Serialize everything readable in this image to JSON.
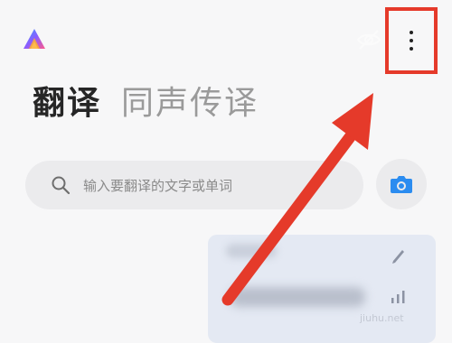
{
  "header": {
    "logo_icon": "app-logo-icon",
    "eye_off_icon": "eye-off-icon",
    "more_icon": "more-vertical-icon",
    "highlight_color": "#e53a2a"
  },
  "tabs": [
    {
      "label": "翻译",
      "active": true
    },
    {
      "label": "同声传译",
      "active": false
    }
  ],
  "search": {
    "placeholder": "输入要翻译的文字或单词",
    "icon": "search-icon"
  },
  "camera": {
    "icon": "camera-icon",
    "color": "#2b8cf0"
  },
  "history_card": {
    "edit_icon": "pencil-icon",
    "audio_icon": "audio-bars-icon",
    "watermark": "jiuhu.net"
  },
  "annotation": {
    "arrow_color": "#e53a2a"
  }
}
